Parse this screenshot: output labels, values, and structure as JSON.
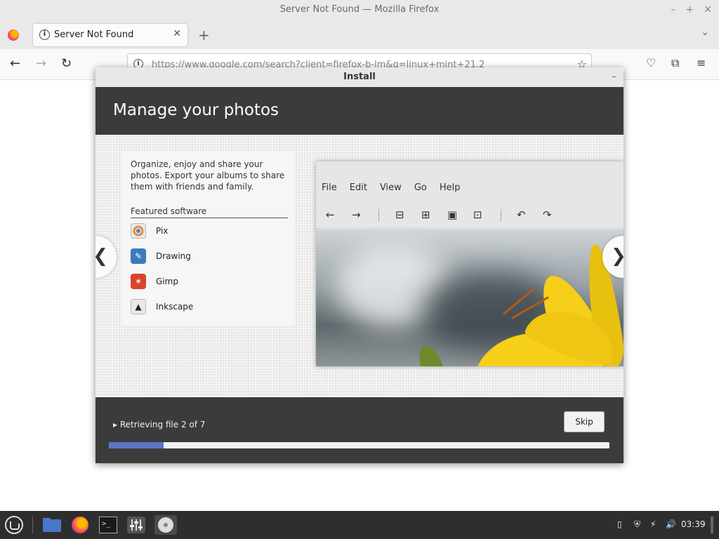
{
  "window": {
    "title": "Server Not Found — Mozilla Firefox",
    "controls": [
      "–",
      "+",
      "✕"
    ]
  },
  "browser": {
    "tab": {
      "label": "Server Not Found",
      "close": "✕"
    },
    "new_tab": "+",
    "tab_list": "⌄",
    "nav": {
      "back": "←",
      "forward": "→",
      "reload": "↻"
    },
    "url": "https://www.google.com/search?client=firefox-b-lm&q=linux+mint+21.2",
    "bookmark": "☆",
    "pocket": "♡",
    "extensions": "⧉",
    "menu": "≡"
  },
  "installer": {
    "title": "Install",
    "minimize": "–",
    "heading": "Manage your photos",
    "description": "Organize, enjoy and share your photos. Export your albums to share them with friends and family.",
    "featured_title": "Featured software",
    "apps": [
      {
        "name": "Pix",
        "icon": "pix-icon",
        "color": "#e8e8e8"
      },
      {
        "name": "Drawing",
        "icon": "drawing-icon",
        "color": "#3a7bbf"
      },
      {
        "name": "Gimp",
        "icon": "gimp-icon",
        "color": "#d9452c"
      },
      {
        "name": "Inkscape",
        "icon": "inkscape-icon",
        "color": "#e8e8e8"
      }
    ],
    "preview_menu": [
      "File",
      "Edit",
      "View",
      "Go",
      "Help"
    ],
    "prev_arrow": "❮",
    "next_arrow": "❯",
    "status": "Retrieving file 2 of 7",
    "skip": "Skip",
    "progress": 0.11,
    "progress_color": "#5c75c4"
  },
  "taskbar": {
    "clock": "03:39"
  }
}
